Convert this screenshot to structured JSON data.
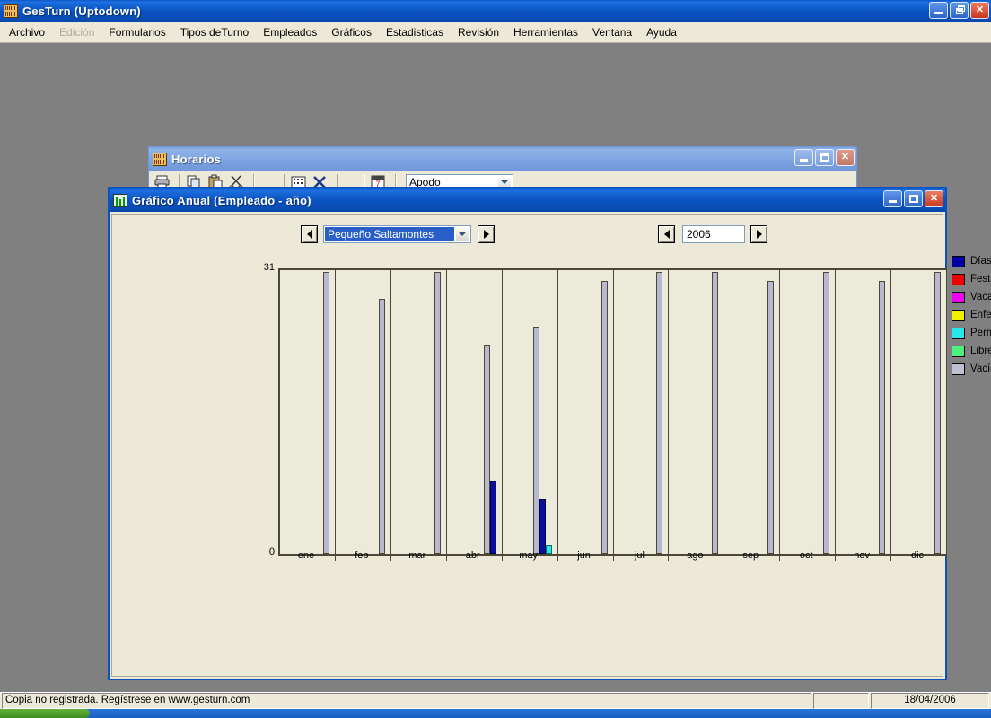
{
  "app": {
    "title": "GesTurn (Uptodown)",
    "icon": "app-grid-icon",
    "window_buttons": {
      "minimize": "_",
      "restore": "❐",
      "close": "✕"
    }
  },
  "menu": {
    "items": [
      {
        "label": "Archivo",
        "disabled": false
      },
      {
        "label": "Edición",
        "disabled": true
      },
      {
        "label": "Formularios",
        "disabled": false
      },
      {
        "label": "Tipos deTurno",
        "disabled": false
      },
      {
        "label": "Empleados",
        "disabled": false
      },
      {
        "label": "Gráficos",
        "disabled": false
      },
      {
        "label": "Estadisticas",
        "disabled": false
      },
      {
        "label": "Revisión",
        "disabled": false
      },
      {
        "label": "Herramientas",
        "disabled": false
      },
      {
        "label": "Ventana",
        "disabled": false
      },
      {
        "label": "Ayuda",
        "disabled": false
      }
    ]
  },
  "horarios_window": {
    "title": "Horarios",
    "icon": "app-grid-icon",
    "toolbar": {
      "buttons": [
        "print-icon",
        "copy-icon",
        "paste-icon",
        "cut-icon",
        "grid-icon",
        "delete-x-icon",
        "calendar-icon"
      ],
      "field_combo_value": "Apodo"
    }
  },
  "grafico_window": {
    "title": "Gráfico Anual  (Empleado - año)",
    "icon": "chart-bars-icon",
    "employee_selector": {
      "prev_label": "◀",
      "next_label": "▶",
      "value": "Pequeño Saltamontes"
    },
    "year_selector": {
      "prev_label": "◀",
      "next_label": "▶",
      "value": "2006"
    }
  },
  "chart_data": {
    "type": "bar",
    "title": "",
    "xlabel": "",
    "ylabel": "",
    "ylim": [
      0,
      31
    ],
    "ytick_labels": [
      "0",
      "31"
    ],
    "grid": false,
    "legend_position": "right",
    "categories": [
      "ene",
      "feb",
      "mar",
      "abr",
      "may",
      "jun",
      "jul",
      "ago",
      "sep",
      "oct",
      "nov",
      "dic"
    ],
    "series": [
      {
        "name": "Días trabajados",
        "color": "#0d0d9e",
        "values": [
          0,
          0,
          0,
          8,
          6,
          0,
          0,
          0,
          0,
          0,
          0,
          0
        ]
      },
      {
        "name": "Festivos",
        "color": "#ee0000",
        "values": [
          0,
          0,
          0,
          0,
          0,
          0,
          0,
          0,
          0,
          0,
          0,
          0
        ]
      },
      {
        "name": "Vacaciones",
        "color": "#f000f0",
        "values": [
          0,
          0,
          0,
          0,
          0,
          0,
          0,
          0,
          0,
          0,
          0,
          0
        ]
      },
      {
        "name": "Enfermedad",
        "color": "#f0f000",
        "values": [
          0,
          0,
          0,
          0,
          0,
          0,
          0,
          0,
          0,
          0,
          0,
          0
        ]
      },
      {
        "name": "Permisos",
        "color": "#26e8e8",
        "values": [
          0,
          0,
          0,
          0,
          1,
          0,
          0,
          0,
          0,
          0,
          0,
          0
        ]
      },
      {
        "name": "Libres",
        "color": "#4cf07c",
        "values": [
          0,
          0,
          0,
          0,
          0,
          0,
          0,
          0,
          0,
          0,
          0,
          0
        ]
      },
      {
        "name": "Vacíos",
        "color": "#b8b8d0",
        "values": [
          31,
          28,
          31,
          23,
          25,
          30,
          31,
          31,
          30,
          31,
          30,
          31
        ]
      }
    ]
  },
  "legend": {
    "items": [
      {
        "label": "Días trabajados",
        "color": "#0000a0"
      },
      {
        "label": "Festivos",
        "color": "#ee0000"
      },
      {
        "label": "Vacaciones",
        "color": "#f000f0"
      },
      {
        "label": "Enfermedad",
        "color": "#f0f000"
      },
      {
        "label": "Permisos",
        "color": "#26e8e8"
      },
      {
        "label": "Libres",
        "color": "#4cf07c"
      },
      {
        "label": "Vacíos",
        "color": "#c0c0d4"
      }
    ]
  },
  "statusbar": {
    "message": "Copia no registrada. Regístrese en www.gesturn.com",
    "date": "18/04/2006"
  }
}
